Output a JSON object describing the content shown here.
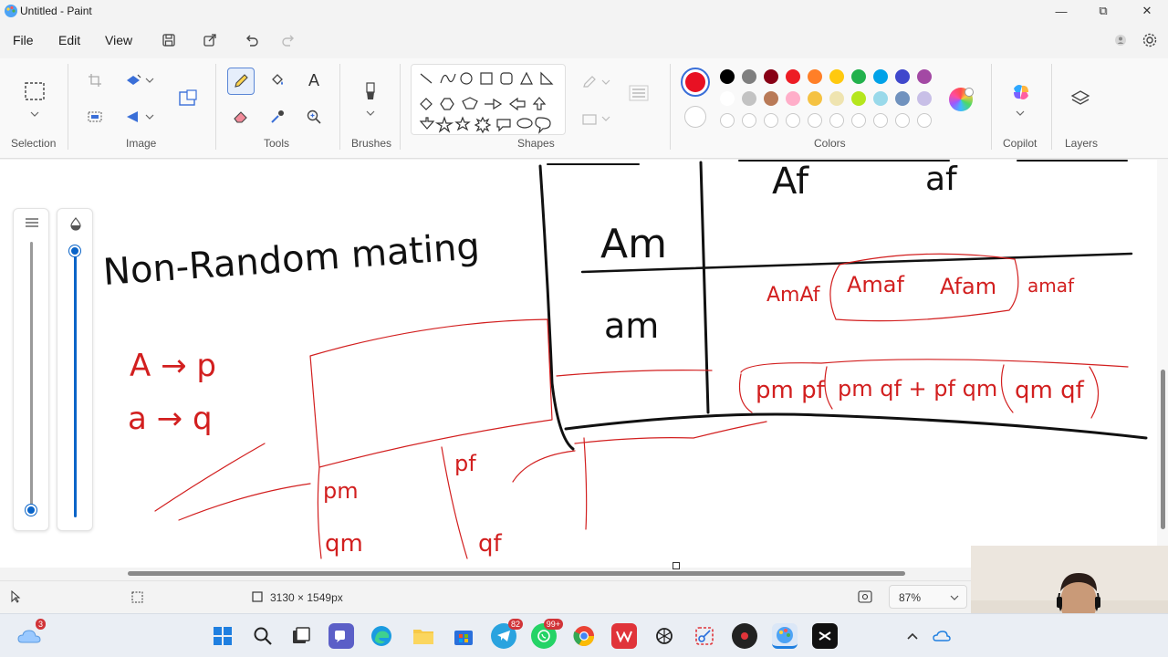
{
  "window": {
    "title": "Untitled - Paint",
    "minimize_glyph": "—",
    "maximize_glyph": "⧉",
    "close_glyph": "✕"
  },
  "menu": {
    "file": "File",
    "edit": "Edit",
    "view": "View"
  },
  "toolbar_icons": [
    "save-icon",
    "share-icon",
    "undo-icon",
    "redo-icon"
  ],
  "ribbon": {
    "groups": {
      "selection": "Selection",
      "image": "Image",
      "tools": "Tools",
      "brushes": "Brushes",
      "shapes": "Shapes",
      "colors": "Colors",
      "copilot": "Copilot",
      "layers": "Layers"
    },
    "text_tool_glyph": "A",
    "active_tool": "pencil",
    "active_color": "#e81123",
    "palette_row1": [
      "#000000",
      "#7f7f7f",
      "#880015",
      "#ed1c24",
      "#ff7f27",
      "#ffc90e",
      "#22b14c",
      "#00a2e8",
      "#3f48cc",
      "#a349a4"
    ],
    "palette_row2": [
      "#ffffff",
      "#c3c3c3",
      "#b97a57",
      "#ffaec9",
      "#f5c242",
      "#efe4b0",
      "#b5e61d",
      "#99d9ea",
      "#7092be",
      "#c8bfe7"
    ]
  },
  "canvas": {
    "handwriting": {
      "heading": "Non-Random mating",
      "col_female_dominant": "Af",
      "col_female_recessive": "af",
      "row_male_dominant": "Am",
      "row_male_recessive": "am",
      "cell_genotypes": [
        "AmAf",
        "Amaf",
        "Afam",
        "amaf"
      ],
      "cell_products": [
        "pm pf",
        "pm qf + pf qm",
        "qm qf"
      ],
      "side_note_1": "A → p",
      "side_note_2": "a → q",
      "margin_labels": [
        "pf",
        "pm",
        "qm",
        "qf"
      ]
    }
  },
  "status": {
    "canvas_size": "3130 × 1549px",
    "zoom": "87%"
  },
  "taskbar": {
    "weather_badge": "3",
    "telegram_badge": "82",
    "whatsapp_badge": "99+"
  }
}
